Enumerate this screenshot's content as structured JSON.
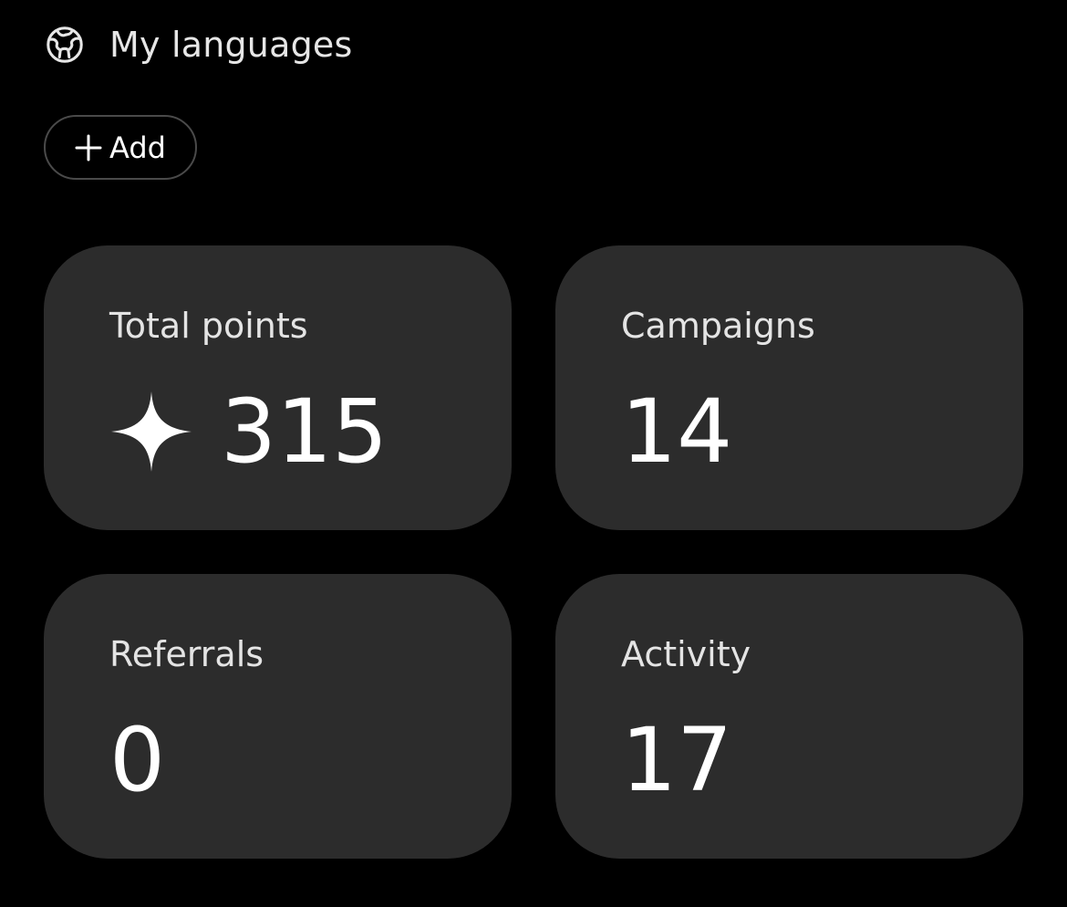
{
  "languages": {
    "icon": "globe-icon",
    "title": "My languages",
    "add_label": "Add",
    "add_icon": "plus-icon"
  },
  "stats": {
    "total_points": {
      "label": "Total points",
      "value": "315",
      "icon": "sparkle-icon"
    },
    "campaigns": {
      "label": "Campaigns",
      "value": "14"
    },
    "referrals": {
      "label": "Referrals",
      "value": "0"
    },
    "activity": {
      "label": "Activity",
      "value": "17"
    }
  },
  "colors": {
    "background": "#000000",
    "card": "#2c2c2c",
    "text": "#ffffff",
    "button_border": "#4a4a4a"
  }
}
